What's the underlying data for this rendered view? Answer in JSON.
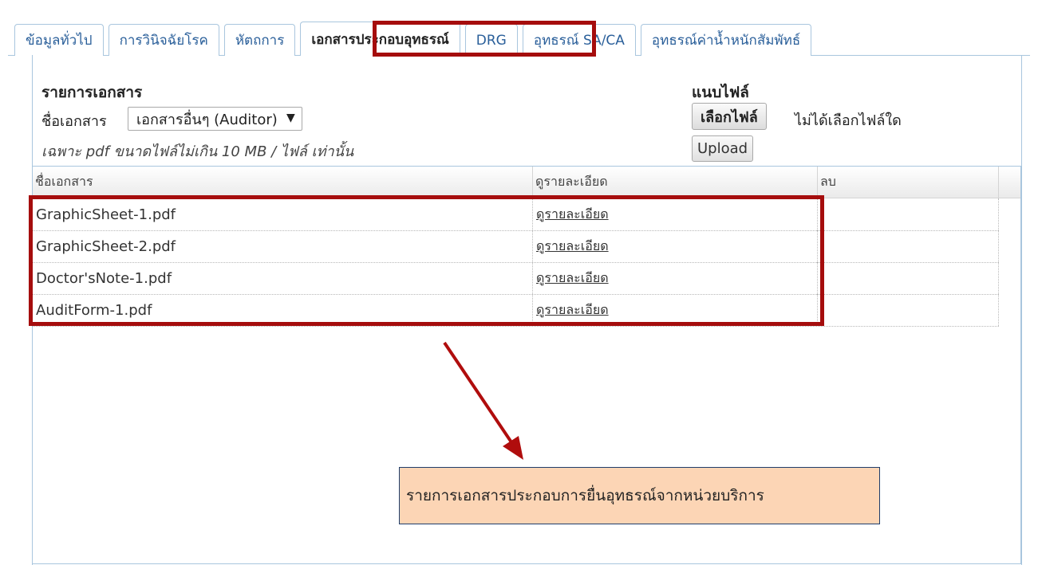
{
  "tabs": [
    {
      "label": "ข้อมูลทั่วไป"
    },
    {
      "label": "การวินิจฉัยโรค"
    },
    {
      "label": "หัตถการ"
    },
    {
      "label": "เอกสารประกอบอุทธรณ์"
    },
    {
      "label": "DRG"
    },
    {
      "label": "อุทธรณ์ SA/CA"
    },
    {
      "label": "อุทธรณ์ค่าน้ำหนักสัมพัทธ์"
    }
  ],
  "documents": {
    "title": "รายการเอกสาร",
    "name_label": "ชื่อเอกสาร",
    "selected_type": "เอกสารอื่นๆ (Auditor)",
    "note": "เฉพาะ pdf ขนาดไฟล์ไม่เกิน 10 MB /  ไฟล์ เท่านั้น"
  },
  "attach": {
    "title": "แนบไฟล์",
    "choose_label": "เลือกไฟล์",
    "no_file": "ไม่ได้เลือกไฟล์ใด",
    "upload_label": "Upload"
  },
  "table": {
    "headers": [
      "ชื่อเอกสาร",
      "ดูรายละเอียด",
      "ลบ"
    ],
    "rows": [
      {
        "name": "GraphicSheet-1.pdf",
        "detail": "ดูรายละเอียด",
        "delete": ""
      },
      {
        "name": "GraphicSheet-2.pdf",
        "detail": "ดูรายละเอียด",
        "delete": ""
      },
      {
        "name": "Doctor'sNote-1.pdf",
        "detail": "ดูรายละเอียด",
        "delete": ""
      },
      {
        "name": "AuditForm-1.pdf",
        "detail": "ดูรายละเอียด",
        "delete": ""
      }
    ]
  },
  "callout": {
    "text": "รายการเอกสารประกอบการยื่นอุทธรณ์จากหน่วยบริการ"
  },
  "colors": {
    "highlight": "#a50d0d",
    "callout_bg": "#fcd5b5",
    "tab_text": "#2a5f9a"
  }
}
